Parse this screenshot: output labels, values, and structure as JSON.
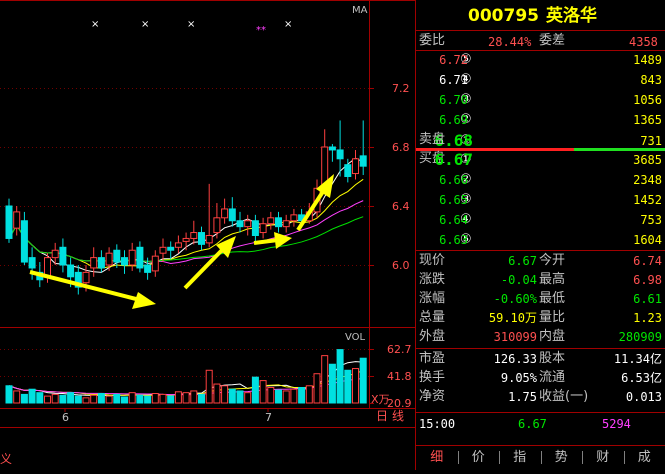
{
  "stock": {
    "code": "000795",
    "name": "英洛华"
  },
  "chart": {
    "ma_label": "MA",
    "price_ticks": [
      "7.2",
      "6.8",
      "6.4",
      "6.0"
    ],
    "vol_label": "VOL",
    "vol_ticks": [
      "62.7",
      "41.8",
      "20.9"
    ],
    "vol_unit": "X万",
    "x_labels": [
      "6",
      "7"
    ],
    "left_cut": "义",
    "period_tab": "日",
    "period_tab2": "线",
    "markers": [
      "×",
      "×",
      "×",
      "**",
      "×"
    ]
  },
  "order_book": {
    "weibi_label": "委比",
    "weibi_value": "28.44%",
    "weicha_label": "委差",
    "weicha_value": "4358",
    "sell_label": "卖盘",
    "buy_label": "买盘",
    "sell": [
      {
        "idx": "⑤",
        "price": "6.72",
        "vol": "1489"
      },
      {
        "idx": "④",
        "price": "6.71",
        "vol": "843"
      },
      {
        "idx": "③",
        "price": "6.70",
        "vol": "1056"
      },
      {
        "idx": "②",
        "price": "6.69",
        "vol": "1365"
      },
      {
        "idx": "①",
        "price": "6.68",
        "vol": "731"
      }
    ],
    "buy": [
      {
        "idx": "①",
        "price": "6.67",
        "vol": "3685"
      },
      {
        "idx": "②",
        "price": "6.66",
        "vol": "2348"
      },
      {
        "idx": "③",
        "price": "6.65",
        "vol": "1452"
      },
      {
        "idx": "④",
        "price": "6.64",
        "vol": "753"
      },
      {
        "idx": "⑤",
        "price": "6.63",
        "vol": "1604"
      }
    ]
  },
  "quote": {
    "rows": [
      {
        "l1": "现价",
        "v1": "6.67",
        "l2": "今开",
        "v2": "6.74"
      },
      {
        "l1": "涨跌",
        "v1": "-0.04",
        "l2": "最高",
        "v2": "6.98"
      },
      {
        "l1": "涨幅",
        "v1": "-0.60%",
        "l2": "最低",
        "v2": "6.61"
      },
      {
        "l1": "总量",
        "v1": "59.10万",
        "l2": "量比",
        "v2": "1.23"
      },
      {
        "l1": "外盘",
        "v1": "310099",
        "l2": "内盘",
        "v2": "280909"
      }
    ],
    "rows2": [
      {
        "l1": "市盈",
        "v1": "126.33",
        "l2": "股本",
        "v2": "11.34亿"
      },
      {
        "l1": "换手",
        "v1": "9.05%",
        "l2": "流通",
        "v2": "6.53亿"
      },
      {
        "l1": "净资",
        "v1": "1.75",
        "l2": "收益(一)",
        "v2": "0.013"
      }
    ]
  },
  "tick": {
    "time": "15:00",
    "price": "6.67",
    "vol": "5294"
  },
  "tabs": [
    "细",
    "价",
    "指",
    "势",
    "财",
    "成"
  ],
  "colors": {
    "up": "#ff5050",
    "down": "#00e600",
    "flat": "#ffffff",
    "accent": "#ffff00"
  }
}
